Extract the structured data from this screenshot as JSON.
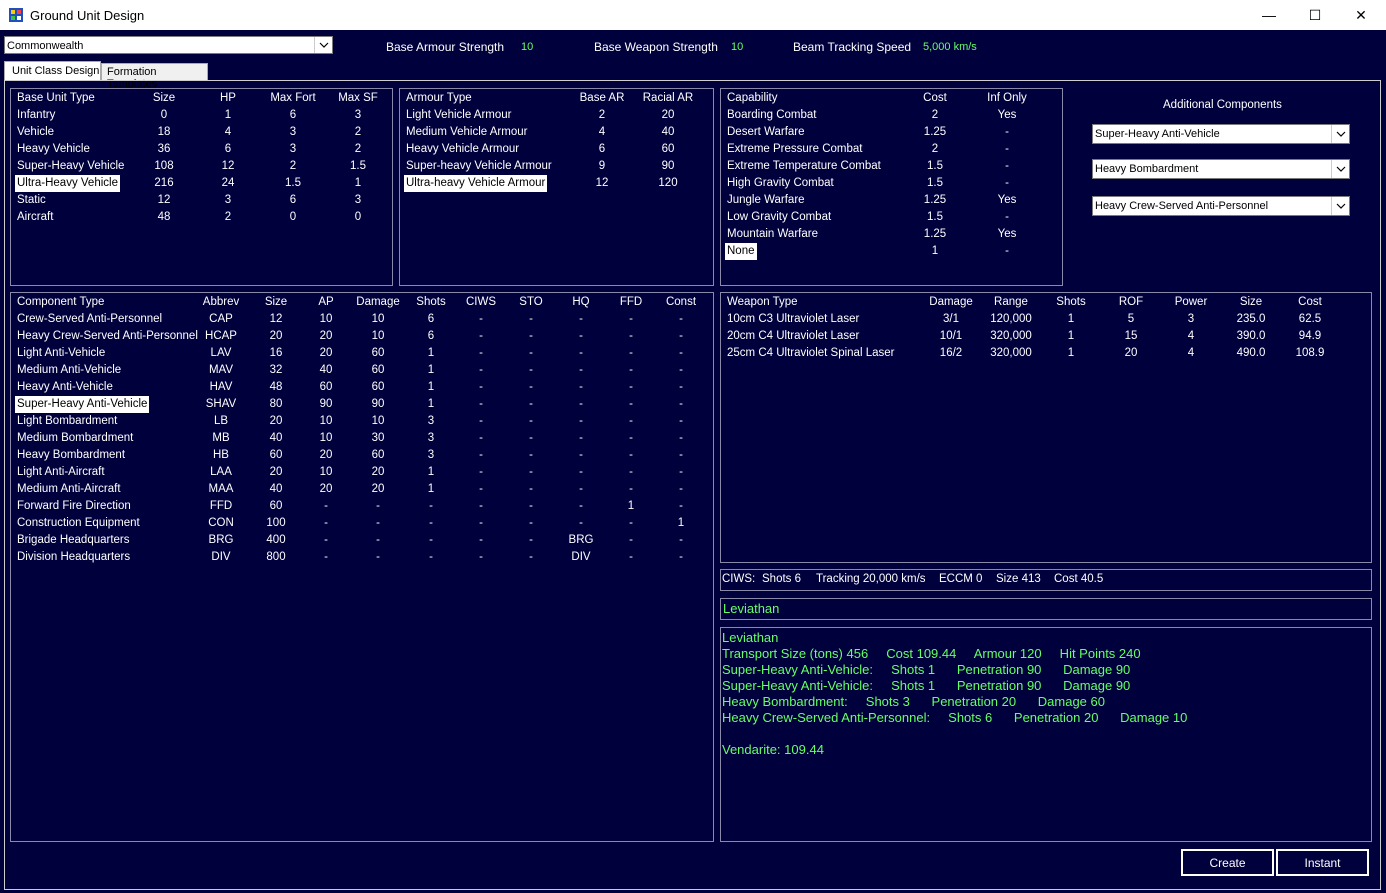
{
  "window": {
    "title": "Ground Unit Design",
    "minimize": "—",
    "maximize": "☐",
    "close": "✕"
  },
  "race_select": "Commonwealth",
  "stats": {
    "armour_label": "Base Armour Strength",
    "armour_value": "10",
    "weapon_label": "Base Weapon Strength",
    "weapon_value": "10",
    "beam_label": "Beam Tracking Speed",
    "beam_value": "5,000 km/s"
  },
  "tabs": [
    "Unit Class Design",
    "Formation Templates"
  ],
  "base_unit": {
    "headers": [
      "Base Unit Type",
      "Size",
      "HP",
      "Max Fort",
      "Max SF"
    ],
    "rows": [
      [
        "Infantry",
        "0",
        "1",
        "6",
        "3"
      ],
      [
        "Vehicle",
        "18",
        "4",
        "3",
        "2"
      ],
      [
        "Heavy Vehicle",
        "36",
        "6",
        "3",
        "2"
      ],
      [
        "Super-Heavy Vehicle",
        "108",
        "12",
        "2",
        "1.5"
      ],
      [
        "Ultra-Heavy Vehicle",
        "216",
        "24",
        "1.5",
        "1"
      ],
      [
        "Static",
        "12",
        "3",
        "6",
        "3"
      ],
      [
        "Aircraft",
        "48",
        "2",
        "0",
        "0"
      ]
    ],
    "selected": 4
  },
  "armour": {
    "headers": [
      "Armour Type",
      "Base AR",
      "Racial AR"
    ],
    "rows": [
      [
        "Light Vehicle Armour",
        "2",
        "20"
      ],
      [
        "Medium Vehicle Armour",
        "4",
        "40"
      ],
      [
        "Heavy Vehicle Armour",
        "6",
        "60"
      ],
      [
        "Super-heavy Vehicle Armour",
        "9",
        "90"
      ],
      [
        "Ultra-heavy Vehicle Armour",
        "12",
        "120"
      ]
    ],
    "selected": 4
  },
  "capability": {
    "headers": [
      "Capability",
      "Cost",
      "Inf Only"
    ],
    "rows": [
      [
        "Boarding Combat",
        "2",
        "Yes"
      ],
      [
        "Desert Warfare",
        "1.25",
        "-"
      ],
      [
        "Extreme Pressure Combat",
        "2",
        "-"
      ],
      [
        "Extreme Temperature Combat",
        "1.5",
        "-"
      ],
      [
        "High Gravity Combat",
        "1.5",
        "-"
      ],
      [
        "Jungle Warfare",
        "1.25",
        "Yes"
      ],
      [
        "Low Gravity Combat",
        "1.5",
        "-"
      ],
      [
        "Mountain Warfare",
        "1.25",
        "Yes"
      ],
      [
        "None",
        "1",
        "-"
      ]
    ],
    "selected": 8
  },
  "additional": {
    "title": "Additional Components",
    "slots": [
      "Super-Heavy Anti-Vehicle",
      "Heavy Bombardment",
      "Heavy Crew-Served Anti-Personnel"
    ]
  },
  "components": {
    "headers": [
      "Component Type",
      "Abbrev",
      "Size",
      "AP",
      "Damage",
      "Shots",
      "CIWS",
      "STO",
      "HQ",
      "FFD",
      "Const"
    ],
    "rows": [
      [
        "Crew-Served Anti-Personnel",
        "CAP",
        "12",
        "10",
        "10",
        "6",
        "-",
        "-",
        "-",
        "-",
        "-"
      ],
      [
        "Heavy Crew-Served Anti-Personnel",
        "HCAP",
        "20",
        "20",
        "10",
        "6",
        "-",
        "-",
        "-",
        "-",
        "-"
      ],
      [
        "Light Anti-Vehicle",
        "LAV",
        "16",
        "20",
        "60",
        "1",
        "-",
        "-",
        "-",
        "-",
        "-"
      ],
      [
        "Medium Anti-Vehicle",
        "MAV",
        "32",
        "40",
        "60",
        "1",
        "-",
        "-",
        "-",
        "-",
        "-"
      ],
      [
        "Heavy Anti-Vehicle",
        "HAV",
        "48",
        "60",
        "60",
        "1",
        "-",
        "-",
        "-",
        "-",
        "-"
      ],
      [
        "Super-Heavy Anti-Vehicle",
        "SHAV",
        "80",
        "90",
        "90",
        "1",
        "-",
        "-",
        "-",
        "-",
        "-"
      ],
      [
        "Light Bombardment",
        "LB",
        "20",
        "10",
        "10",
        "3",
        "-",
        "-",
        "-",
        "-",
        "-"
      ],
      [
        "Medium Bombardment",
        "MB",
        "40",
        "10",
        "30",
        "3",
        "-",
        "-",
        "-",
        "-",
        "-"
      ],
      [
        "Heavy Bombardment",
        "HB",
        "60",
        "20",
        "60",
        "3",
        "-",
        "-",
        "-",
        "-",
        "-"
      ],
      [
        "Light Anti-Aircraft",
        "LAA",
        "20",
        "10",
        "20",
        "1",
        "-",
        "-",
        "-",
        "-",
        "-"
      ],
      [
        "Medium Anti-Aircraft",
        "MAA",
        "40",
        "20",
        "20",
        "1",
        "-",
        "-",
        "-",
        "-",
        "-"
      ],
      [
        "Forward Fire Direction",
        "FFD",
        "60",
        "-",
        "-",
        "-",
        "-",
        "-",
        "-",
        "1",
        "-"
      ],
      [
        "Construction Equipment",
        "CON",
        "100",
        "-",
        "-",
        "-",
        "-",
        "-",
        "-",
        "-",
        "1"
      ],
      [
        "Brigade Headquarters",
        "BRG",
        "400",
        "-",
        "-",
        "-",
        "-",
        "-",
        "BRG",
        "-",
        "-"
      ],
      [
        "Division Headquarters",
        "DIV",
        "800",
        "-",
        "-",
        "-",
        "-",
        "-",
        "DIV",
        "-",
        "-"
      ]
    ],
    "selected": 5
  },
  "weapons": {
    "headers": [
      "Weapon Type",
      "Damage",
      "Range",
      "Shots",
      "ROF",
      "Power",
      "Size",
      "Cost"
    ],
    "rows": [
      [
        "10cm C3 Ultraviolet Laser",
        "3/1",
        "120,000",
        "1",
        "5",
        "3",
        "235.0",
        "62.5"
      ],
      [
        "20cm C4 Ultraviolet Laser",
        "10/1",
        "320,000",
        "1",
        "15",
        "4",
        "390.0",
        "94.9"
      ],
      [
        "25cm C4 Ultraviolet Spinal Laser",
        "16/2",
        "320,000",
        "1",
        "20",
        "4",
        "490.0",
        "108.9"
      ]
    ]
  },
  "ciws": {
    "label": "CIWS:",
    "shots": "Shots 6",
    "tracking": "Tracking 20,000 km/s",
    "eccm": "ECCM 0",
    "size": "Size 413",
    "cost": "Cost 40.5"
  },
  "unit_name": "Leviathan",
  "summary": {
    "name": "Leviathan",
    "line1": "Transport Size (tons) 456     Cost 109.44     Armour 120     Hit Points 240",
    "lines": [
      "Super-Heavy Anti-Vehicle:     Shots 1      Penetration 90      Damage 90",
      "Super-Heavy Anti-Vehicle:     Shots 1      Penetration 90      Damage 90",
      "Heavy Bombardment:     Shots 3      Penetration 20      Damage 60",
      "Heavy Crew-Served Anti-Personnel:     Shots 6      Penetration 20      Damage 10"
    ],
    "footer": "Vendarite: 109.44"
  },
  "buttons": {
    "create": "Create",
    "instant": "Instant"
  }
}
